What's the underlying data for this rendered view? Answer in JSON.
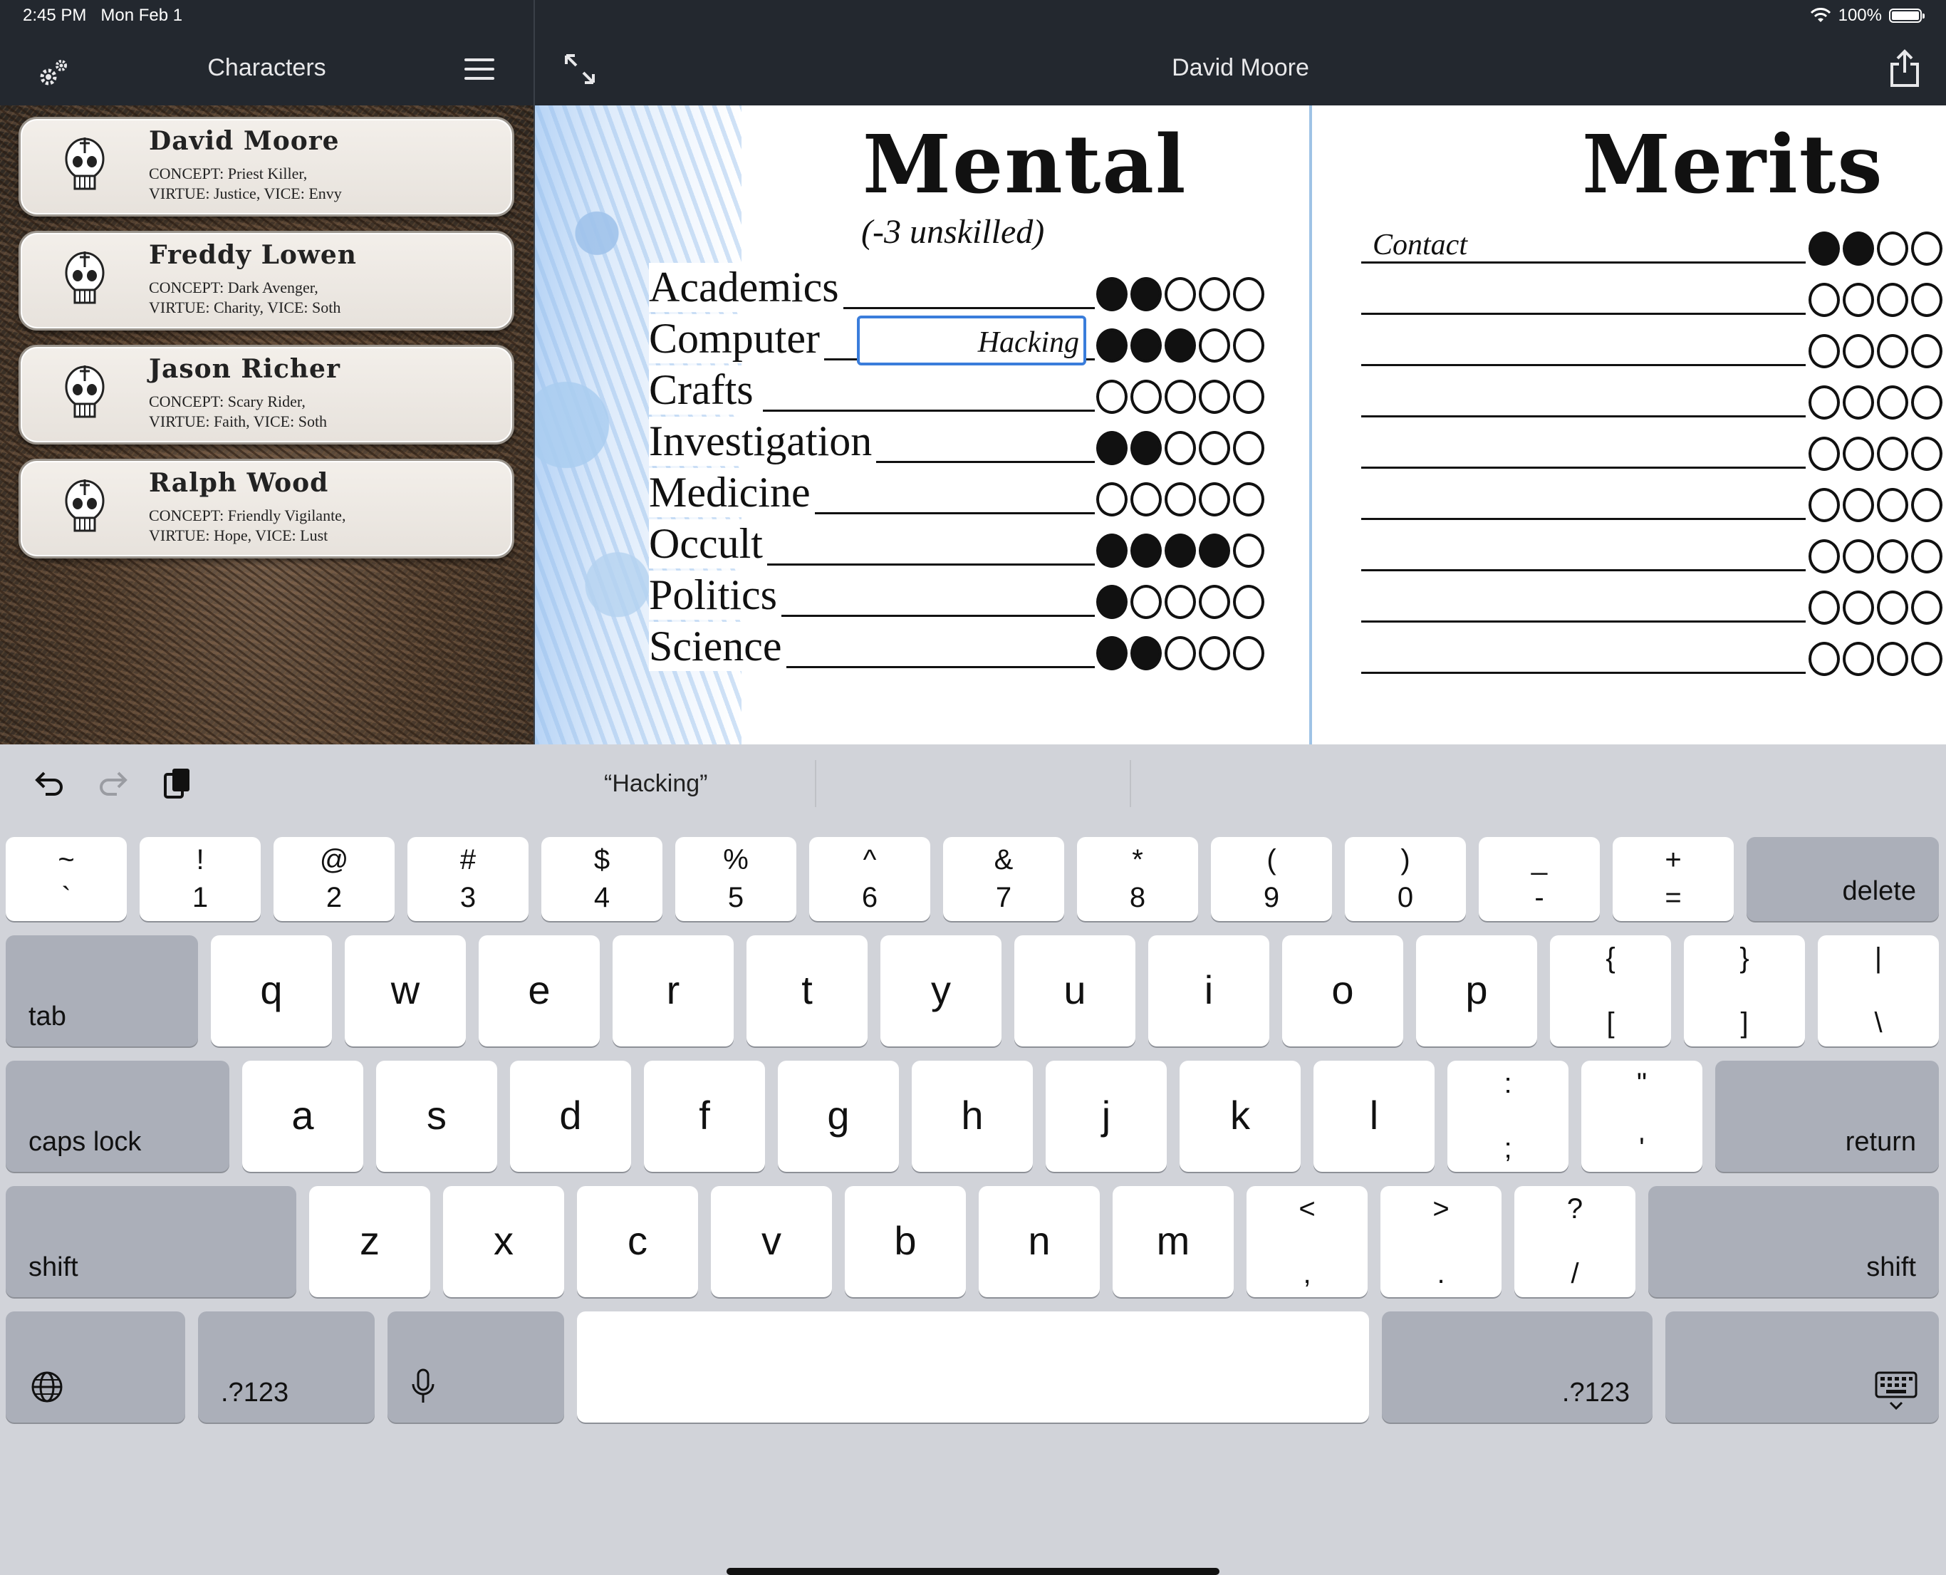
{
  "status": {
    "time": "2:45 PM",
    "date": "Mon Feb 1",
    "battery": "100%"
  },
  "left_panel": {
    "title": "Characters",
    "characters": [
      {
        "name": "David Moore",
        "concept": "CONCEPT: Priest Killer,",
        "virtue_vice": "VIRTUE: Justice, VICE: Envy"
      },
      {
        "name": "Freddy Lowen",
        "concept": "CONCEPT: Dark Avenger,",
        "virtue_vice": "VIRTUE: Charity, VICE: Soth"
      },
      {
        "name": "Jason Richer",
        "concept": "CONCEPT: Scary Rider,",
        "virtue_vice": "VIRTUE: Faith, VICE: Soth"
      },
      {
        "name": "Ralph Wood",
        "concept": "CONCEPT: Friendly Vigilante,",
        "virtue_vice": "VIRTUE: Hope, VICE: Lust"
      }
    ]
  },
  "right_panel": {
    "title": "David Moore",
    "mental": {
      "title": "Mental",
      "subtitle": "(-3 unskilled)",
      "skills": [
        {
          "name": "Academics",
          "dots": 2
        },
        {
          "name": "Computer",
          "dots": 3,
          "specialty": "Hacking"
        },
        {
          "name": "Crafts",
          "dots": 0
        },
        {
          "name": "Investigation",
          "dots": 2
        },
        {
          "name": "Medicine",
          "dots": 0
        },
        {
          "name": "Occult",
          "dots": 4
        },
        {
          "name": "Politics",
          "dots": 1
        },
        {
          "name": "Science",
          "dots": 2
        }
      ]
    },
    "merits": {
      "title": "Merits",
      "items": [
        {
          "name": "Contact",
          "dots": 2
        },
        {
          "name": "",
          "dots": 0
        },
        {
          "name": "",
          "dots": 0
        },
        {
          "name": "",
          "dots": 0
        },
        {
          "name": "",
          "dots": 0
        },
        {
          "name": "",
          "dots": 0
        },
        {
          "name": "",
          "dots": 0
        },
        {
          "name": "",
          "dots": 0
        },
        {
          "name": "",
          "dots": 0
        }
      ]
    }
  },
  "keyboard": {
    "suggestion": "“Hacking”",
    "row1": [
      {
        "top": "~",
        "bot": "`"
      },
      {
        "top": "!",
        "bot": "1"
      },
      {
        "top": "@",
        "bot": "2"
      },
      {
        "top": "#",
        "bot": "3"
      },
      {
        "top": "$",
        "bot": "4"
      },
      {
        "top": "%",
        "bot": "5"
      },
      {
        "top": "^",
        "bot": "6"
      },
      {
        "top": "&",
        "bot": "7"
      },
      {
        "top": "*",
        "bot": "8"
      },
      {
        "top": "(",
        "bot": "9"
      },
      {
        "top": ")",
        "bot": "0"
      },
      {
        "top": "_",
        "bot": "-"
      },
      {
        "top": "+",
        "bot": "="
      }
    ],
    "row2": [
      "q",
      "w",
      "e",
      "r",
      "t",
      "y",
      "u",
      "i",
      "o",
      "p"
    ],
    "row2_extra": [
      {
        "top": "{",
        "bot": "["
      },
      {
        "top": "}",
        "bot": "]"
      },
      {
        "top": "|",
        "bot": "\\"
      }
    ],
    "row3": [
      "a",
      "s",
      "d",
      "f",
      "g",
      "h",
      "j",
      "k",
      "l"
    ],
    "row3_extra": [
      {
        "top": ":",
        "bot": ";"
      },
      {
        "top": "\"",
        "bot": "'"
      }
    ],
    "row4": [
      "z",
      "x",
      "c",
      "v",
      "b",
      "n",
      "m"
    ],
    "row4_extra": [
      {
        "top": "<",
        "bot": ","
      },
      {
        "top": ">",
        "bot": "."
      },
      {
        "top": "?",
        "bot": "/"
      }
    ],
    "labels": {
      "delete": "delete",
      "tab": "tab",
      "caps": "caps lock",
      "return": "return",
      "shift_left": "shift",
      "shift_right": "shift",
      "num_left": ".?123",
      "num_right": ".?123"
    }
  }
}
